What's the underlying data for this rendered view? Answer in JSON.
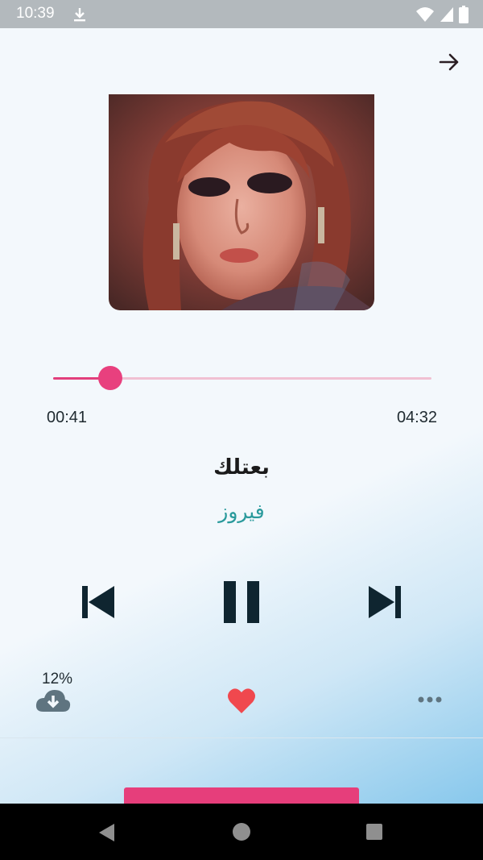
{
  "status_bar": {
    "time": "10:39",
    "icons": [
      "download-icon",
      "wifi-icon",
      "signal-icon",
      "battery-icon"
    ]
  },
  "header": {
    "back_icon": "arrow-right-icon"
  },
  "player": {
    "elapsed": "00:41",
    "duration": "04:32",
    "progress_fraction": 0.151,
    "title": "بعتلك",
    "artist": "فيروز",
    "controls": [
      "skip-previous-icon",
      "pause-icon",
      "skip-next-icon"
    ]
  },
  "actions": {
    "download_percent": "12%",
    "download_icon": "cloud-download-icon",
    "favorite_icon": "heart-icon",
    "more_icon": "more-horizontal-icon"
  },
  "colors": {
    "accent": "#e8407e",
    "artist": "#2a9a9c",
    "controls": "#0f2530",
    "heart": "#f0484e"
  }
}
